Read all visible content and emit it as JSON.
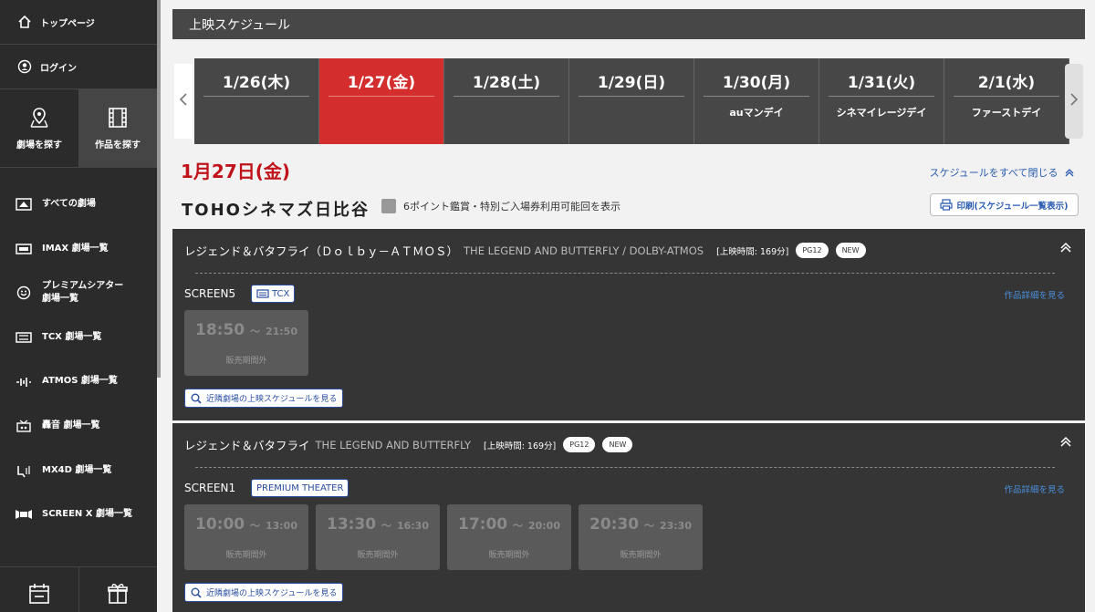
{
  "sidebar": {
    "top_page": "トップページ",
    "login": "ログイン",
    "find_theater": "劇場を探す",
    "find_movie": "作品を探す",
    "items": [
      {
        "label": "すべての劇場",
        "icon": "screen-icon"
      },
      {
        "label": "IMAX 劇場一覧",
        "icon": "imax-icon"
      },
      {
        "label": "プレミアムシアター 劇場一覧",
        "icon": "premium-icon"
      },
      {
        "label": "TCX 劇場一覧",
        "icon": "tcx-icon"
      },
      {
        "label": "ATMOS 劇場一覧",
        "icon": "atmos-icon"
      },
      {
        "label": "轟音 劇場一覧",
        "icon": "goon-icon"
      },
      {
        "label": "MX4D 劇場一覧",
        "icon": "mx4d-icon"
      },
      {
        "label": "SCREEN X 劇場一覧",
        "icon": "screenx-icon"
      }
    ]
  },
  "header": {
    "title": "上映スケジュール"
  },
  "dates": [
    {
      "label": "1/26(木)",
      "sub": ""
    },
    {
      "label": "1/27(金)",
      "sub": "",
      "selected": true
    },
    {
      "label": "1/28(土)",
      "sub": ""
    },
    {
      "label": "1/29(日)",
      "sub": ""
    },
    {
      "label": "1/30(月)",
      "sub": "auマンデイ"
    },
    {
      "label": "1/31(火)",
      "sub": "シネマイレージデイ"
    },
    {
      "label": "2/1(水)",
      "sub": "ファーストデイ"
    }
  ],
  "schedule": {
    "selected_date": "1月27日(金)",
    "close_all": "スケジュールをすべて閉じる",
    "theater_name": "TOHOシネマズ日比谷",
    "filter_label": "6ポイント鑑賞・特別ご入場券利用可能回を表示",
    "print_label": "印刷(スケジュール一覧表示)"
  },
  "movies": [
    {
      "title_jp": "レジェンド＆バタフライ（Ｄｏｌｂｙ－ＡＴＭＯＳ）",
      "title_en": "THE LEGEND AND BUTTERFLY / DOLBY-ATMOS",
      "runtime": "[上映時間: 169分]",
      "rating": "PG12",
      "new_badge": "NEW",
      "screen": "SCREEN5",
      "screen_badge": "TCX",
      "detail_link": "作品詳細を見る",
      "showtimes": [
        {
          "start": "18:50",
          "sep": "～",
          "end": "21:50",
          "status": "販売期間外"
        }
      ],
      "nearby": "近隣劇場の上映スケジュールを見る"
    },
    {
      "title_jp": "レジェンド＆バタフライ",
      "title_en": "THE LEGEND AND BUTTERFLY",
      "runtime": "[上映時間: 169分]",
      "rating": "PG12",
      "new_badge": "NEW",
      "screen": "SCREEN1",
      "screen_badge": "PREMIUM THEATER",
      "detail_link": "作品詳細を見る",
      "showtimes": [
        {
          "start": "10:00",
          "sep": "～",
          "end": "13:00",
          "status": "販売期間外"
        },
        {
          "start": "13:30",
          "sep": "～",
          "end": "16:30",
          "status": "販売期間外"
        },
        {
          "start": "17:00",
          "sep": "～",
          "end": "20:00",
          "status": "販売期間外"
        },
        {
          "start": "20:30",
          "sep": "～",
          "end": "23:30",
          "status": "販売期間外"
        }
      ],
      "nearby": "近隣劇場の上映スケジュールを見る"
    }
  ],
  "colors": {
    "accent_red": "#d42d2d",
    "date_red_text": "#c0141a",
    "link_blue": "#2a5cb0",
    "dark_panel": "#353535"
  }
}
